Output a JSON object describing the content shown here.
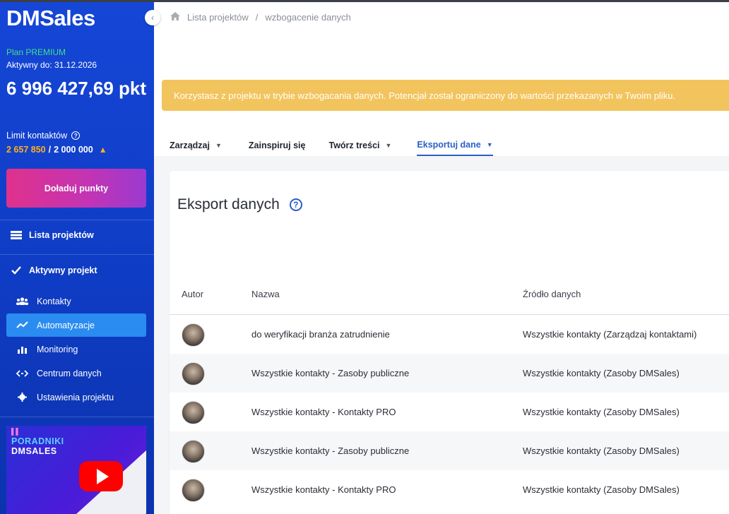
{
  "sidebar": {
    "logo": "DMSales",
    "plan": "Plan PREMIUM",
    "active_until": "Aktywny do: 31.12.2026",
    "points": "6 996 427,69 pkt",
    "limit_label": "Limit kontaktów",
    "limit_used": "2 657 850",
    "limit_separator": "/",
    "limit_total": "2 000 000",
    "topup_button": "Doładuj punkty",
    "nav_projects": "Lista projektów",
    "nav_active_project": "Aktywny projekt",
    "subnav": [
      {
        "label": "Kontakty",
        "icon": "users-icon",
        "active": false
      },
      {
        "label": "Automatyzacje",
        "icon": "trend-icon",
        "active": true
      },
      {
        "label": "Monitoring",
        "icon": "bar-chart-icon",
        "active": false
      },
      {
        "label": "Centrum danych",
        "icon": "code-arrows-icon",
        "active": false
      },
      {
        "label": "Ustawienia projektu",
        "icon": "gear-icon",
        "active": false
      }
    ],
    "promo": {
      "title_line1": "PORADNIKI",
      "title_line2": "DMSALES"
    }
  },
  "breadcrumb": {
    "root": "Lista projektów",
    "separator": "/",
    "current": "wzbogacenie danych"
  },
  "alert": {
    "text": "Korzystasz z projektu w trybie wzbogacania danych. Potencjał został ograniczony do wartości przekazanych w Twoim pliku."
  },
  "tabs": [
    {
      "label": "Zarządzaj",
      "has_chevron": true,
      "active": false
    },
    {
      "label": "Zainspiruj się",
      "has_chevron": false,
      "active": false
    },
    {
      "label": "Twórz treści",
      "has_chevron": true,
      "active": false
    },
    {
      "label": "Eksportuj dane",
      "has_chevron": true,
      "active": true
    }
  ],
  "export": {
    "title": "Eksport danych",
    "columns": {
      "author": "Autor",
      "name": "Nazwa",
      "source": "Źródło danych"
    },
    "rows": [
      {
        "name": "do weryfikacji branża zatrudnienie",
        "source": "Wszystkie kontakty (Zarządzaj kontaktami)"
      },
      {
        "name": "Wszystkie kontakty - Zasoby publiczne",
        "source": "Wszystkie kontakty (Zasoby DMSales)"
      },
      {
        "name": "Wszystkie kontakty - Kontakty PRO",
        "source": "Wszystkie kontakty (Zasoby DMSales)"
      },
      {
        "name": "Wszystkie kontakty - Zasoby publiczne",
        "source": "Wszystkie kontakty (Zasoby DMSales)"
      },
      {
        "name": "Wszystkie kontakty - Kontakty PRO",
        "source": "Wszystkie kontakty (Zasoby DMSales)"
      }
    ]
  },
  "colors": {
    "sidebar_blue": "#1546d6",
    "active_item": "#2a8cf0",
    "alert": "#f2c45d",
    "accent": "#2b5fc7",
    "plan_green": "#3ee08a",
    "warning": "#ffb020"
  }
}
